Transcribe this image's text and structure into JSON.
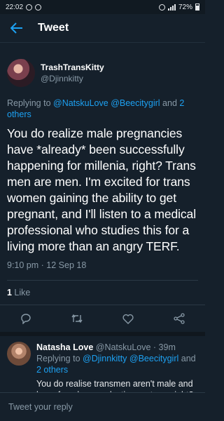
{
  "status_bar": {
    "time": "22:02",
    "battery": "72%"
  },
  "header": {
    "title": "Tweet"
  },
  "tweet": {
    "author_name": "TrashTransKitty",
    "author_handle": "@Djinnkitty",
    "replying_prefix": "Replying to ",
    "replying_mention_1": "@NatskuLove",
    "replying_mention_2": "@Beecitygirl",
    "replying_and": " and ",
    "replying_others": "2 others",
    "text": "You do realize male pregnancies have *already* been successfully happening for millenia, right? Trans men are men. I'm excited for trans women gaining the ability to get pregnant, and I'll listen to a medical professional who studies this for a living more than an angry TERF.",
    "timestamp": "9:10 pm · 12 Sep 18",
    "likes_count": "1",
    "likes_label": " Like"
  },
  "reply": {
    "author_name": "Natasha Love",
    "meta": " @NatskuLove · 39m",
    "replying_prefix": "Replying to ",
    "replying_mention_1": "@Djinnkitty",
    "replying_mention_2": "@Beecitygirl",
    "replying_and": " and ",
    "replying_others": "2 others",
    "text": "You do realise transmen aren't male and have female reproductive systems right? You do realise there are significant"
  },
  "composer": {
    "placeholder": "Tweet your reply"
  },
  "colors": {
    "background": "#15202b",
    "accent": "#1da1f2",
    "muted": "#8899a6"
  },
  "icons": [
    "back-arrow-icon",
    "reply-icon",
    "retweet-icon",
    "like-icon",
    "share-icon"
  ]
}
